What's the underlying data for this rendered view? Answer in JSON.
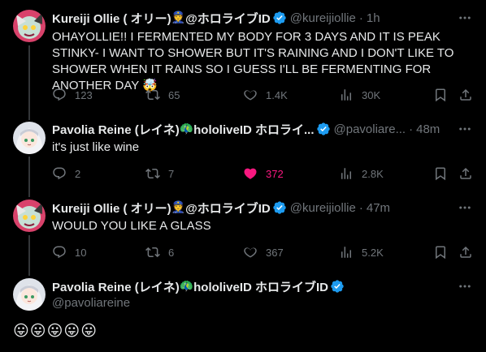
{
  "tweets": [
    {
      "name": "Kureiji Ollie ( オリー) ",
      "name_suffix": " @ホロライブID",
      "handle": "@kureijiollie",
      "time": "1h",
      "text": "OHAYOLLIE!! I FERMENTED MY BODY FOR 3 DAYS AND IT IS PEAK STINKY- I WANT TO SHOWER BUT IT'S RAINING AND I DON'T LIKE TO SHOWER WHEN IT RAINS SO I GUESS I'LL BE FERMENTING FOR ANOTHER DAY 🤯",
      "replies": "123",
      "retweets": "65",
      "likes": "1.4K",
      "views": "30K",
      "liked": false
    },
    {
      "name": "Pavolia Reine (レイネ)",
      "name_suffix": "hololiveID ホロライ...",
      "handle": "@pavoliare...",
      "time": "48m",
      "text": "it's just like wine",
      "replies": "2",
      "retweets": "7",
      "likes": "372",
      "views": "2.8K",
      "liked": true
    },
    {
      "name": "Kureiji Ollie ( オリー) ",
      "name_suffix": " @ホロライブID",
      "handle": "@kureijiollie",
      "time": "47m",
      "text": "WOULD YOU LIKE A GLASS",
      "replies": "10",
      "retweets": "6",
      "likes": "367",
      "views": "5.2K",
      "liked": false
    },
    {
      "name": "Pavolia Reine (レイネ)",
      "name_suffix": "hololiveID ホロライブID",
      "handle": "@pavoliareine",
      "text": "😛😛😛😛😛"
    }
  ],
  "colors": {
    "background": "#000000",
    "text": "#e7e9ea",
    "muted": "#71767b",
    "verified": "#1d9bf0",
    "like": "#f91880",
    "thread_line": "#333639"
  },
  "icons": [
    "more-icon",
    "reply-icon",
    "retweet-icon",
    "like-icon",
    "views-icon",
    "bookmark-icon",
    "share-icon",
    "verified-icon"
  ]
}
